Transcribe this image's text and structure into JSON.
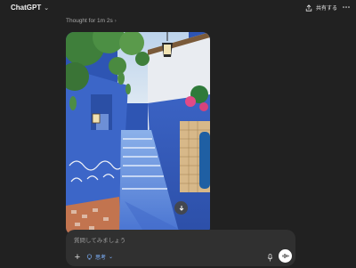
{
  "header": {
    "app_title": "ChatGPT",
    "share_label": "共有する"
  },
  "message": {
    "thought_label": "Thought for 1m 2s",
    "image_description_icon": "download-icon"
  },
  "composer": {
    "placeholder": "質問してみましょう",
    "think_label": "思考"
  },
  "colors": {
    "background": "#212121",
    "composer": "#303030",
    "accent_blue": "#7fb3ff"
  }
}
